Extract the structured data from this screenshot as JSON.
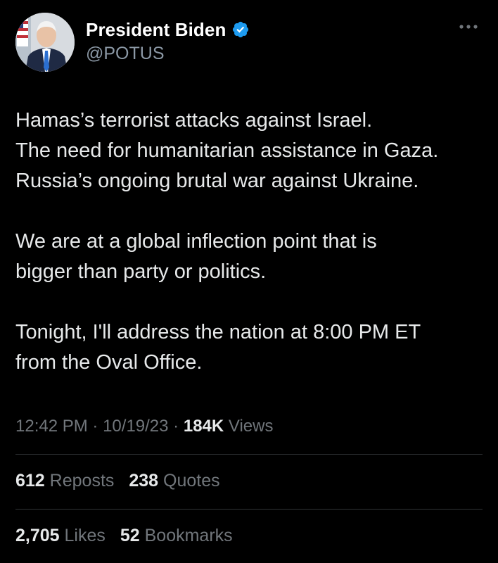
{
  "author": {
    "display_name": "President Biden",
    "handle": "@POTUS",
    "verified_color": "#1d9bf0"
  },
  "icons": {
    "avatar": "profile-photo",
    "verified": "verified-badge-icon",
    "more": "more-options-icon"
  },
  "tweet": {
    "lines": [
      "Hamas’s terrorist attacks against Israel.",
      "The need for humanitarian assistance in Gaza.",
      "Russia’s ongoing brutal war against Ukraine.",
      "",
      "We are at a global inflection point that is",
      "bigger than party or politics.",
      "",
      "Tonight, I'll address the nation at 8:00 PM ET",
      "from the Oval Office."
    ]
  },
  "meta": {
    "time": "12:42 PM",
    "separator": "·",
    "date": "10/19/23",
    "views_count": "184K",
    "views_label": "Views"
  },
  "stats": {
    "reposts_count": "612",
    "reposts_label": "Reposts",
    "quotes_count": "238",
    "quotes_label": "Quotes",
    "likes_count": "2,705",
    "likes_label": "Likes",
    "bookmarks_count": "52",
    "bookmarks_label": "Bookmarks"
  }
}
